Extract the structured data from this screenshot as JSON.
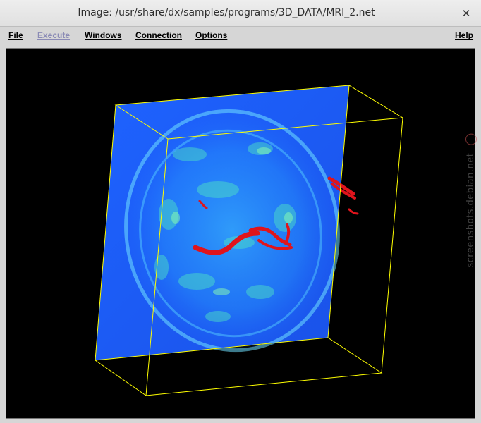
{
  "window": {
    "title": "Image: /usr/share/dx/samples/programs/3D_DATA/MRI_2.net",
    "close_glyph": "✕"
  },
  "menu": {
    "file": "File",
    "execute": "Execute",
    "windows": "Windows",
    "connection": "Connection",
    "options": "Options",
    "help": "Help"
  },
  "watermark": "screenshots.debian.net",
  "colors": {
    "slice_blue": "#1a5cff",
    "bounding_box": "#ffff00",
    "isosurface": "#e0141c",
    "background": "#000000"
  }
}
